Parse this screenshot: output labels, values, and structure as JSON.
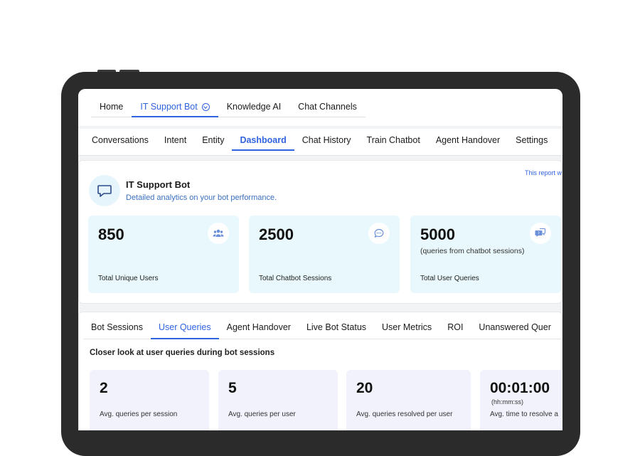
{
  "top_tabs": [
    {
      "label": "Home",
      "active": false
    },
    {
      "label": "IT Support Bot",
      "active": true
    },
    {
      "label": "Knowledge AI",
      "active": false
    },
    {
      "label": "Chat Channels",
      "active": false
    }
  ],
  "sub_tabs": [
    {
      "label": "Conversations",
      "active": false
    },
    {
      "label": "Intent",
      "active": false
    },
    {
      "label": "Entity",
      "active": false
    },
    {
      "label": "Dashboard",
      "active": true
    },
    {
      "label": "Chat History",
      "active": false
    },
    {
      "label": "Train Chatbot",
      "active": false
    },
    {
      "label": "Agent Handover",
      "active": false
    },
    {
      "label": "Settings",
      "active": false
    }
  ],
  "report_note": "This report w",
  "bot": {
    "name": "IT Support Bot",
    "description": "Detailed analytics on your bot performance."
  },
  "kpis": [
    {
      "value": "850",
      "sub": "",
      "label": "Total Unique Users",
      "icon": "users-icon"
    },
    {
      "value": "2500",
      "sub": "",
      "label": "Total Chatbot Sessions",
      "icon": "chat-bubble-icon"
    },
    {
      "value": "5000",
      "sub": "(queries from chatbot sessions)",
      "label": "Total User Queries",
      "icon": "query-chat-icon"
    }
  ],
  "analytics_tabs": [
    {
      "label": "Bot Sessions",
      "active": false
    },
    {
      "label": "User Queries",
      "active": true
    },
    {
      "label": "Agent Handover",
      "active": false
    },
    {
      "label": "Live Bot Status",
      "active": false
    },
    {
      "label": "User Metrics",
      "active": false
    },
    {
      "label": "ROI",
      "active": false
    },
    {
      "label": "Unanswered Quer",
      "active": false
    }
  ],
  "section_title": "Closer look at user queries during bot sessions",
  "metrics": [
    {
      "value": "2",
      "unit": "",
      "label": "Avg. queries per session"
    },
    {
      "value": "5",
      "unit": "",
      "label": "Avg. queries per user"
    },
    {
      "value": "20",
      "unit": "",
      "label": "Avg. queries resolved per user"
    },
    {
      "value": "00:01:00",
      "unit": "(hh:mm:ss)",
      "label": "Avg. time to resolve a"
    }
  ],
  "colors": {
    "accent": "#2f63e0",
    "kpi_bg": "#e8f8fc",
    "metric_bg": "#f1f2fb"
  }
}
